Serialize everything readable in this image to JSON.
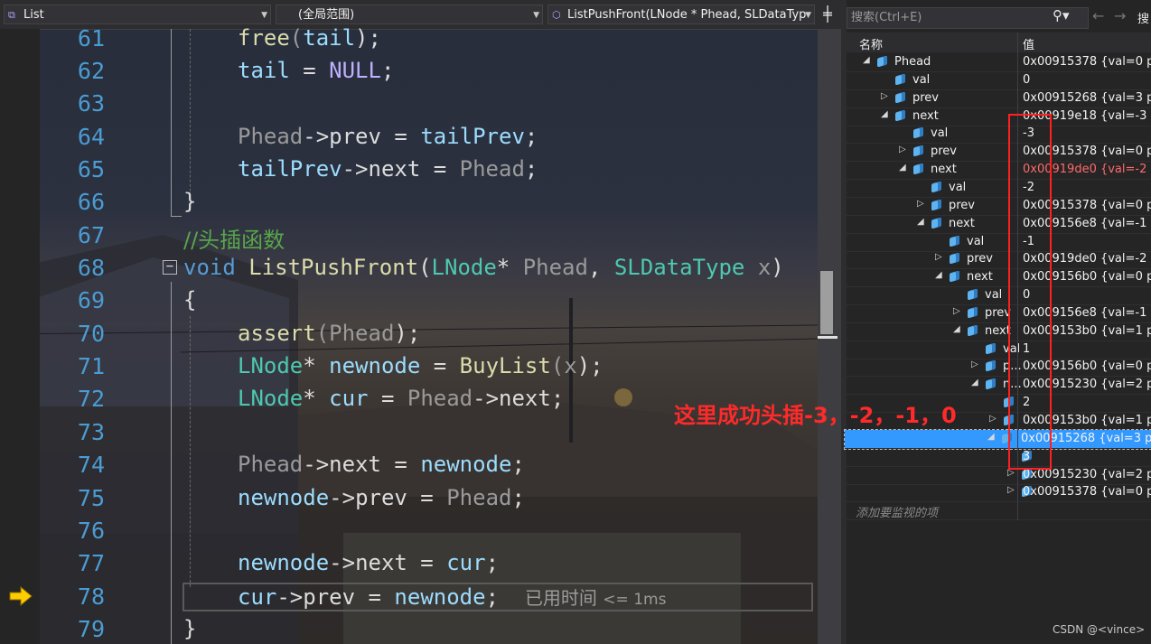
{
  "toolbar": {
    "project": "List",
    "scope": "(全局范围)",
    "function": "ListPushFront(LNode * Phead, SLDataTyp"
  },
  "editor": {
    "line_numbers": [
      "61",
      "62",
      "63",
      "64",
      "65",
      "66",
      "67",
      "68",
      "69",
      "70",
      "71",
      "72",
      "73",
      "74",
      "75",
      "76",
      "77",
      "78",
      "79"
    ],
    "lines": {
      "l61": [
        "free",
        "(",
        "tail",
        ");"
      ],
      "l62": [
        "tail",
        " = ",
        "NULL",
        ";"
      ],
      "l64": [
        "Phead",
        "->",
        "prev",
        " = ",
        "tailPrev",
        ";"
      ],
      "l65": [
        "tailPrev",
        "->",
        "next",
        " = ",
        "Phead",
        ";"
      ],
      "l66": "}",
      "l67": "//头插函数",
      "l68": [
        "void",
        " ",
        "ListPushFront",
        "(",
        "LNode",
        "* ",
        "Phead",
        ", ",
        "SLDataType",
        " ",
        "x",
        ")"
      ],
      "l69": "{",
      "l70": [
        "assert",
        "(",
        "Phead",
        ");"
      ],
      "l71": [
        "LNode",
        "* ",
        "newnode",
        " = ",
        "BuyList",
        "(",
        "x",
        ");"
      ],
      "l72": [
        "LNode",
        "* ",
        "cur",
        " = ",
        "Phead",
        "->",
        "next",
        ";"
      ],
      "l74": [
        "Phead",
        "->",
        "next",
        " = ",
        "newnode",
        ";"
      ],
      "l75": [
        "newnode",
        "->",
        "prev",
        " = ",
        "Phead",
        ";"
      ],
      "l77": [
        "newnode",
        "->",
        "next",
        " = ",
        "cur",
        ";"
      ],
      "l78": [
        "cur",
        "->",
        "prev",
        " = ",
        "newnode",
        ";"
      ],
      "l79": "}"
    },
    "perf_tip": "已用时间",
    "perf_value": "<= 1ms"
  },
  "watch": {
    "search_placeholder": "搜索(Ctrl+E)",
    "col_name": "名称",
    "col_value": "值",
    "rows": [
      {
        "name": "Phead",
        "value": "0x00915378 {val=0 pre"
      },
      {
        "name": "val",
        "value": "0"
      },
      {
        "name": "prev",
        "value": "0x00915268 {val=3 pre"
      },
      {
        "name": "next",
        "value": "0x00919e18 {val=-3 pre"
      },
      {
        "name": "val",
        "value": "-3"
      },
      {
        "name": "prev",
        "value": "0x00915378 {val=0 pre"
      },
      {
        "name": "next",
        "value": "0x00919de0 {val=-2 pr"
      },
      {
        "name": "val",
        "value": "-2"
      },
      {
        "name": "prev",
        "value": "0x00915378 {val=0 pre"
      },
      {
        "name": "next",
        "value": "0x009156e8 {val=-1 pre"
      },
      {
        "name": "val",
        "value": "-1"
      },
      {
        "name": "prev",
        "value": "0x00919de0 {val=-2 pre"
      },
      {
        "name": "next",
        "value": "0x009156b0 {val=0 pre"
      },
      {
        "name": "val",
        "value": "0"
      },
      {
        "name": "prev",
        "value": "0x009156e8 {val=-1 pre"
      },
      {
        "name": "next",
        "value": "0x009153b0 {val=1 pre"
      },
      {
        "name": "val",
        "value": "1"
      },
      {
        "name": "p...",
        "value": "0x009156b0 {val=0 pre"
      },
      {
        "name": "n...",
        "value": "0x00915230 {val=2 pre"
      },
      {
        "name": "",
        "value": "2"
      },
      {
        "name": "",
        "value": "0x009153b0 {val=1 pre"
      },
      {
        "name": "",
        "value": "0x00915268 {val=3 pre"
      },
      {
        "name": "",
        "value": "3"
      },
      {
        "name": "",
        "value": "0x00915230 {val=2 pre"
      },
      {
        "name": "",
        "value": "0x00915378 {val=0 pre"
      }
    ],
    "add_watch": "添加要监视的项"
  },
  "annotation": "这里成功头插-3，-2，-1，0",
  "watermark": "CSDN @<vince>"
}
